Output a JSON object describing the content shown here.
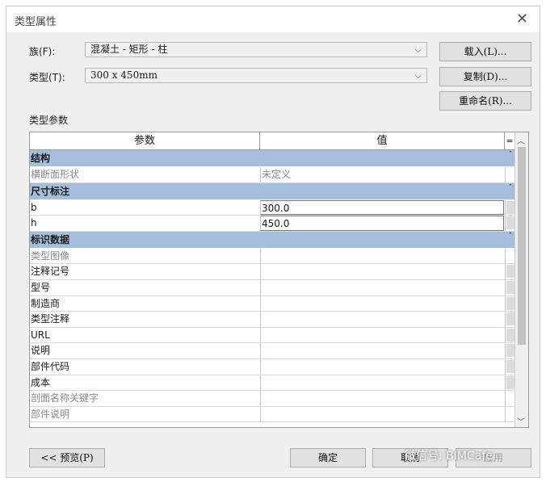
{
  "window": {
    "title": "类型属性"
  },
  "family": {
    "label": "族(F):",
    "value": "混凝土 - 矩形 - 柱"
  },
  "type": {
    "label": "类型(T):",
    "value": "300 x 450mm"
  },
  "buttons": {
    "load": "载入(L)...",
    "duplicate": "复制(D)...",
    "rename": "重命名(R)...",
    "preview": "<< 预览(P)",
    "ok": "确定",
    "cancel": "取消",
    "apply": "应用"
  },
  "params_label": "类型参数",
  "table": {
    "col_param": "参数",
    "col_value": "值",
    "col_eq": "=",
    "groups": [
      {
        "name": "结构",
        "rows": [
          {
            "param": "横断面形状",
            "value": "未定义",
            "readonly": true
          }
        ]
      },
      {
        "name": "尺寸标注",
        "rows": [
          {
            "param": "b",
            "value": "300.0",
            "readonly": false
          },
          {
            "param": "h",
            "value": "450.0",
            "readonly": false
          }
        ]
      },
      {
        "name": "标识数据",
        "rows": [
          {
            "param": "类型图像",
            "value": "",
            "readonly": true
          },
          {
            "param": "注释记号",
            "value": "",
            "readonly": false
          },
          {
            "param": "型号",
            "value": "",
            "readonly": false
          },
          {
            "param": "制造商",
            "value": "",
            "readonly": false
          },
          {
            "param": "类型注释",
            "value": "",
            "readonly": false
          },
          {
            "param": "URL",
            "value": "",
            "readonly": false
          },
          {
            "param": "说明",
            "value": "",
            "readonly": false
          },
          {
            "param": "部件代码",
            "value": "",
            "readonly": false
          },
          {
            "param": "成本",
            "value": "",
            "readonly": false
          },
          {
            "param": "剖面名称关键字",
            "value": "",
            "readonly": true
          },
          {
            "param": "部件说明",
            "value": "",
            "readonly": true
          }
        ]
      }
    ]
  },
  "watermark": "微信号: BIMCafe"
}
